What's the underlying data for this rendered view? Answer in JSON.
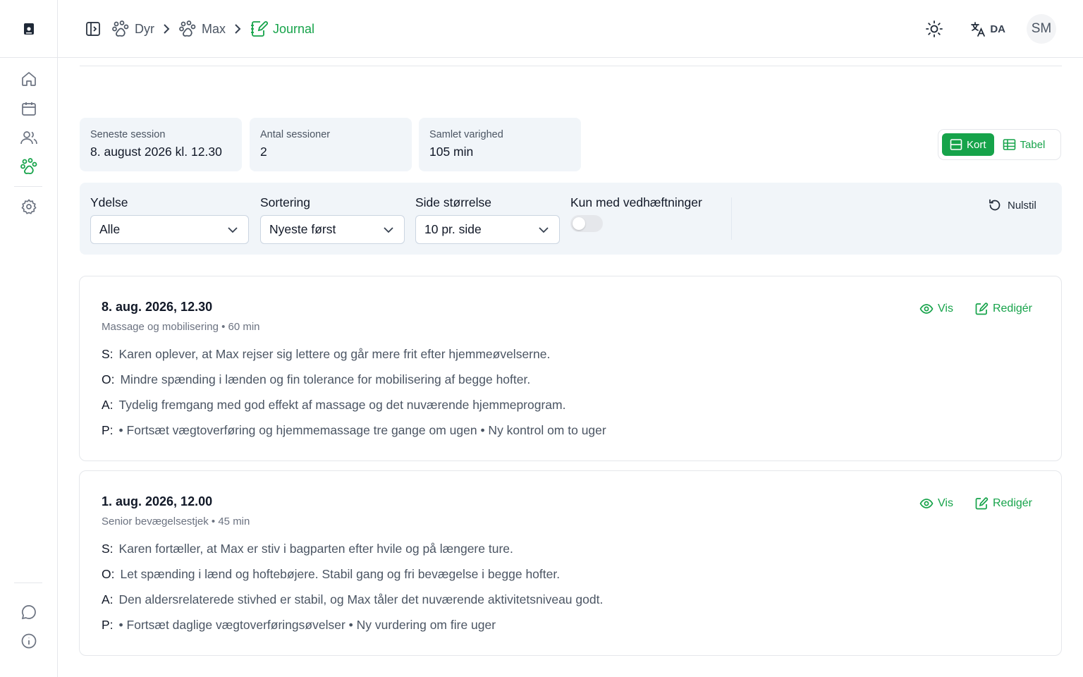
{
  "colors": {
    "accent": "#16a34a",
    "panel": "#f1f5f9",
    "border": "#e5e7eb"
  },
  "breadcrumb": [
    {
      "label": "Dyr",
      "icon": "paw-icon"
    },
    {
      "label": "Max",
      "icon": "paw-icon"
    },
    {
      "label": "Journal",
      "icon": "notebook-pen-icon"
    }
  ],
  "header": {
    "language": "DA",
    "avatar_initials": "SM"
  },
  "stats": [
    {
      "label": "Seneste session",
      "value": "8. august 2026 kl. 12.30"
    },
    {
      "label": "Antal sessioner",
      "value": "2"
    },
    {
      "label": "Samlet varighed",
      "value": "105 min"
    }
  ],
  "view_toggle": {
    "cards_label": "Kort",
    "table_label": "Tabel",
    "selected": "Kort"
  },
  "filters": {
    "service": {
      "label": "Ydelse",
      "value": "Alle"
    },
    "sort": {
      "label": "Sortering",
      "value": "Nyeste først"
    },
    "page_size": {
      "label": "Side størrelse",
      "value": "10 pr. side"
    },
    "attachments_only": {
      "label": "Kun med vedhæftninger",
      "checked": false
    },
    "reset_label": "Nulstil"
  },
  "actions": {
    "view_label": "Vis",
    "edit_label": "Redigér"
  },
  "entries": [
    {
      "title": "8. aug. 2026, 12.30",
      "subtitle": "Massage og mobilisering • 60 min",
      "soap": [
        {
          "key": "S:",
          "text": "Karen oplever, at Max rejser sig lettere og går mere frit efter hjemmeøvelserne."
        },
        {
          "key": "O:",
          "text": "Mindre spænding i lænden og fin tolerance for mobilisering af begge hofter."
        },
        {
          "key": "A:",
          "text": "Tydelig fremgang med god effekt af massage og det nuværende hjemmeprogram."
        },
        {
          "key": "P:",
          "text": "• Fortsæt vægtoverføring og hjemmemassage tre gange om ugen • Ny kontrol om to uger"
        }
      ]
    },
    {
      "title": "1. aug. 2026, 12.00",
      "subtitle": "Senior bevægelsestjek • 45 min",
      "soap": [
        {
          "key": "S:",
          "text": "Karen fortæller, at Max er stiv i bagparten efter hvile og på længere ture."
        },
        {
          "key": "O:",
          "text": "Let spænding i lænd og hoftebøjere. Stabil gang og fri bevægelse i begge hofter."
        },
        {
          "key": "A:",
          "text": "Den aldersrelaterede stivhed er stabil, og Max tåler det nuværende aktivitetsniveau godt."
        },
        {
          "key": "P:",
          "text": "• Fortsæt daglige vægtoverføringsøvelser • Ny vurdering om fire uger"
        }
      ]
    }
  ]
}
